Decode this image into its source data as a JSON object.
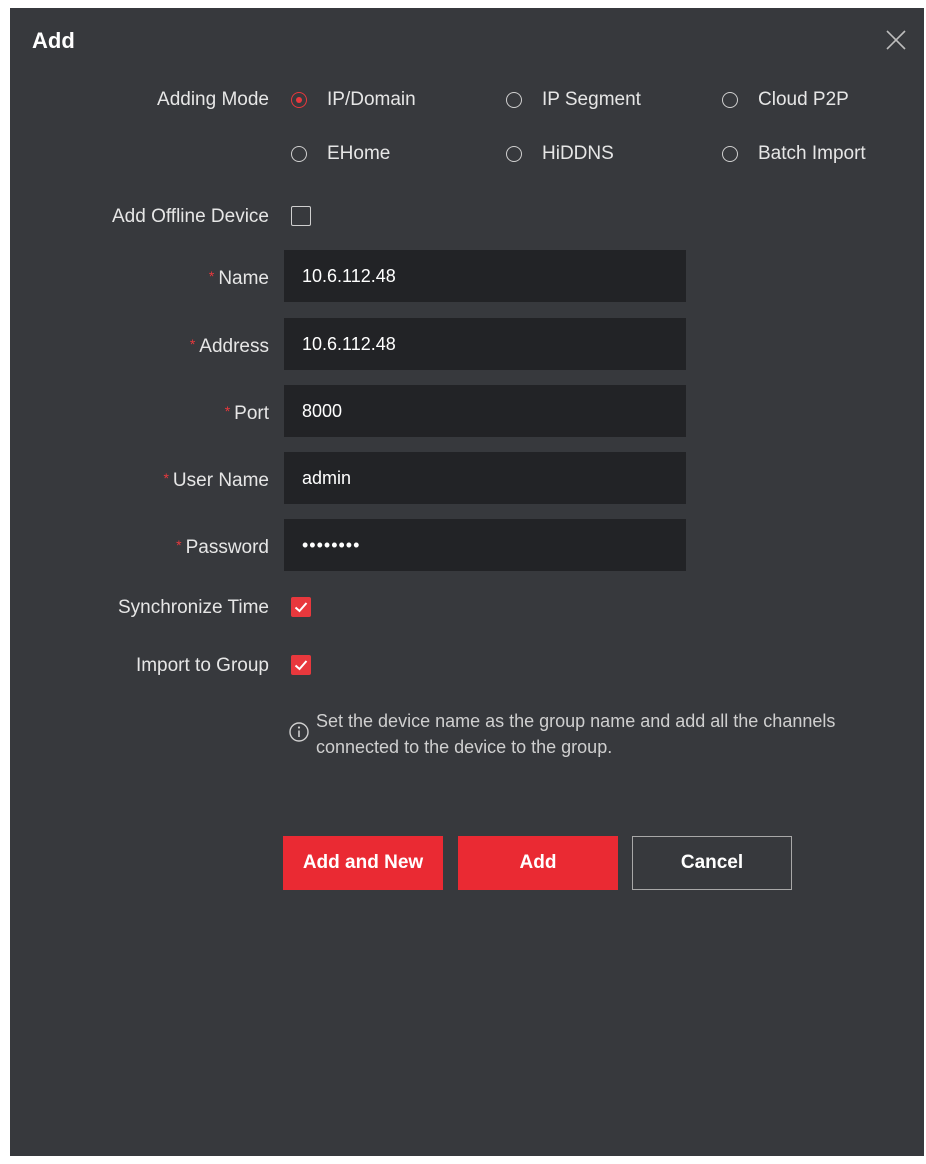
{
  "dialog": {
    "title": "Add"
  },
  "adding_mode": {
    "label": "Adding Mode",
    "options": [
      {
        "label": "IP/Domain",
        "selected": true
      },
      {
        "label": "IP Segment",
        "selected": false
      },
      {
        "label": "Cloud P2P",
        "selected": false
      },
      {
        "label": "EHome",
        "selected": false
      },
      {
        "label": "HiDDNS",
        "selected": false
      },
      {
        "label": "Batch Import",
        "selected": false
      }
    ]
  },
  "offline_device": {
    "label": "Add Offline Device",
    "checked": false
  },
  "fields": {
    "required_mark": "*",
    "name": {
      "label": "Name",
      "value": "10.6.112.48"
    },
    "address": {
      "label": "Address",
      "value": "10.6.112.48"
    },
    "port": {
      "label": "Port",
      "value": "8000"
    },
    "user_name": {
      "label": "User Name",
      "value": "admin"
    },
    "password": {
      "label": "Password",
      "value": "••••••••"
    }
  },
  "sync_time": {
    "label": "Synchronize Time",
    "checked": true
  },
  "import_group": {
    "label": "Import to Group",
    "checked": true
  },
  "hint": {
    "text": "Set the device name as the group name and add all the channels connected to the device to the group."
  },
  "buttons": {
    "add_and_new": "Add and New",
    "add": "Add",
    "cancel": "Cancel"
  },
  "colors": {
    "accent": "#e8383d",
    "background": "#37393d",
    "input_bg": "#222326"
  }
}
